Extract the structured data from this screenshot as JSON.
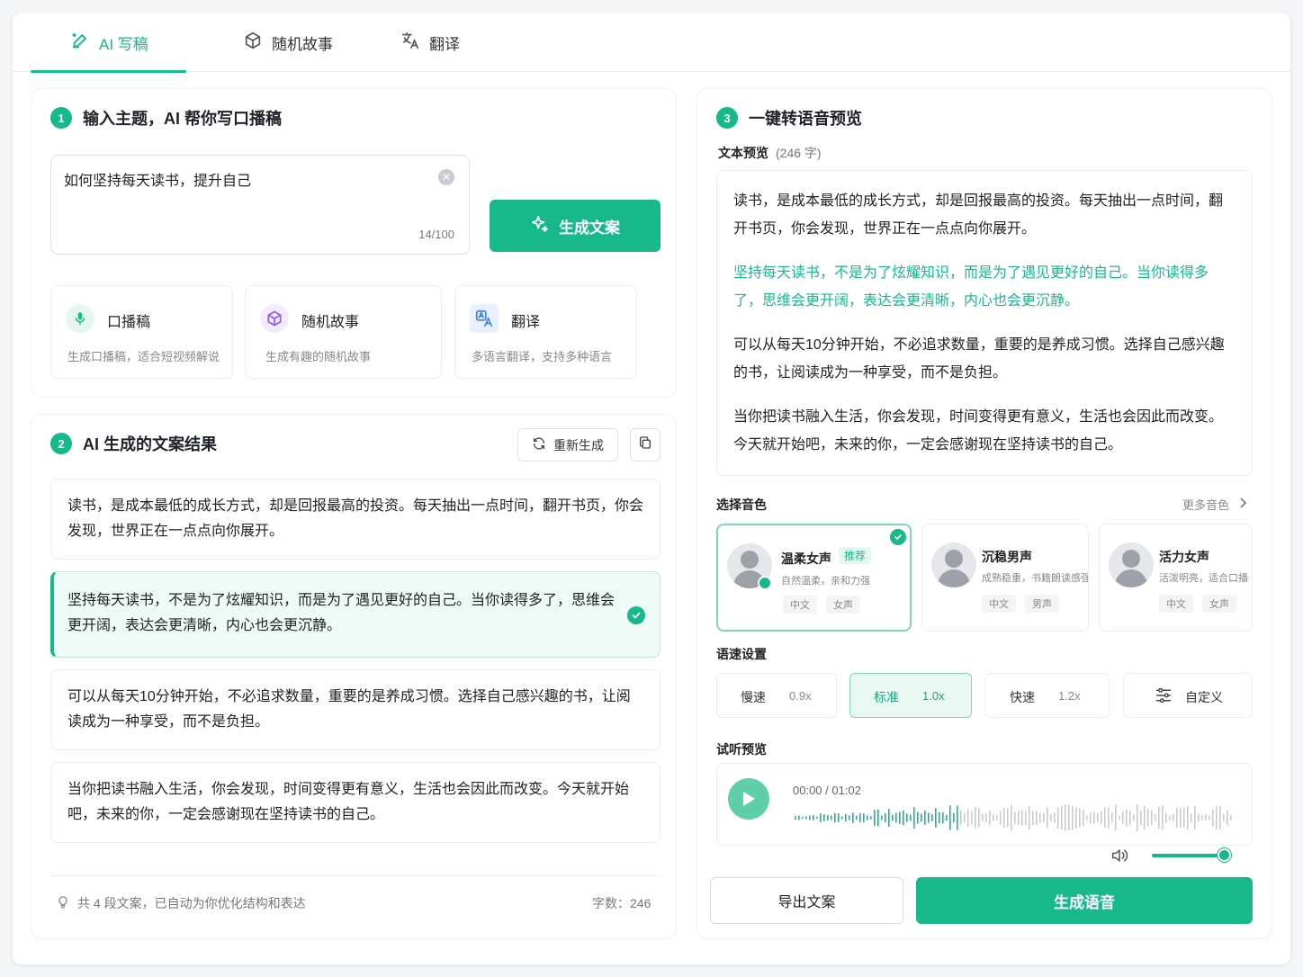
{
  "tabs": [
    {
      "label": "AI 写稿",
      "icon": "pen-sparkle-icon"
    },
    {
      "label": "随机故事",
      "icon": "cube-icon"
    },
    {
      "label": "翻译",
      "icon": "translate-icon"
    }
  ],
  "step1": {
    "num": "1",
    "title": "输入主题，AI 帮你写口播稿",
    "topic_value": "如何坚持每天读书，提升自己",
    "char_count": "14/100",
    "generate_label": "生成文案",
    "modes": [
      {
        "title": "口播稿",
        "desc": "生成口播稿，适合短视频解说",
        "icon": "microphone-icon"
      },
      {
        "title": "随机故事",
        "desc": "生成有趣的随机故事",
        "icon": "cube-icon"
      },
      {
        "title": "翻译",
        "desc": "多语言翻译，支持多种语言",
        "icon": "translate-icon"
      }
    ]
  },
  "step2": {
    "num": "2",
    "title": "AI 生成的文案结果",
    "regen_label": "重新生成",
    "paragraphs": [
      "读书，是成本最低的成长方式，却是回报最高的投资。每天抽出一点时间，翻开书页，你会发现，世界正在一点点向你展开。",
      "坚持每天读书，不是为了炫耀知识，而是为了遇见更好的自己。当你读得多了，思维会更开阔，表达会更清晰，内心也会更沉静。",
      "可以从每天10分钟开始，不必追求数量，重要的是养成习惯。选择自己感兴趣的书，让阅读成为一种享受，而不是负担。",
      "当你把读书融入生活，你会发现，时间变得更有意义，生活也会因此而改变。今天就开始吧，未来的你，一定会感谢现在坚持读书的自己。"
    ],
    "selected_index": 1,
    "footer_tip": "共 4 段文案，已自动为你优化结构和表达",
    "word_count": "字数：246"
  },
  "step3": {
    "num": "3",
    "title": "一键转语音预览",
    "preview_label": "文本预览",
    "preview_count": "(246 字)",
    "preview_paragraphs": [
      "读书，是成本最低的成长方式，却是回报最高的投资。每天抽出一点时间，翻开书页，你会发现，世界正在一点点向你展开。",
      "坚持每天读书，不是为了炫耀知识，而是为了遇见更好的自己。当你读得多了，思维会更开阔，表达会更清晰，内心也会更沉静。",
      "可以从每天10分钟开始，不必追求数量，重要的是养成习惯。选择自己感兴趣的书，让阅读成为一种享受，而不是负担。",
      "当你把读书融入生活，你会发现，时间变得更有意义，生活也会因此而改变。今天就开始吧，未来的你，一定会感谢现在坚持读书的自己。"
    ],
    "voice_label": "选择音色",
    "more_voices": "更多音色",
    "voices": [
      {
        "name": "温柔女声",
        "badge": "推荐",
        "desc": "自然温柔，亲和力强",
        "tags": [
          "中文",
          "女声"
        ],
        "selected": true
      },
      {
        "name": "沉稳男声",
        "desc": "成熟稳重，书籍朗读感强",
        "tags": [
          "中文",
          "男声"
        ]
      },
      {
        "name": "活力女声",
        "desc": "活泼明亮，适合口播",
        "tags": [
          "中文",
          "女声"
        ]
      }
    ],
    "speed_label": "语速设置",
    "speeds": [
      {
        "label": "慢速",
        "value": "0.9x"
      },
      {
        "label": "标准",
        "value": "1.0x",
        "selected": true
      },
      {
        "label": "快速",
        "value": "1.2x"
      }
    ],
    "custom_label": "自定义",
    "listen_label": "试听预览",
    "time": "00:00 / 01:02",
    "volume_level": 1.0,
    "export_label": "导出文案",
    "speak_label": "生成语音"
  },
  "colors": {
    "accent": "#17b98b",
    "accent_light": "#eefaf5"
  }
}
